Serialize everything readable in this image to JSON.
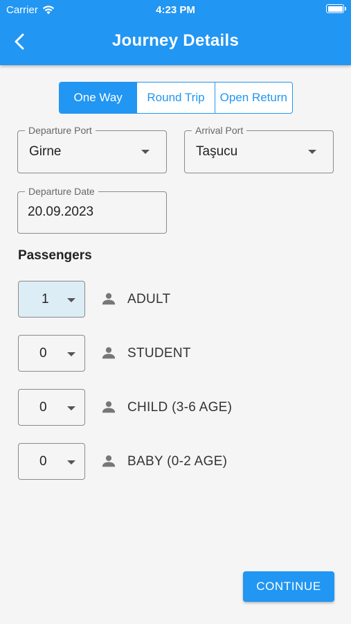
{
  "status": {
    "carrier": "Carrier",
    "time": "4:23 PM"
  },
  "header": {
    "title": "Journey Details"
  },
  "trip_types": [
    {
      "label": "One Way",
      "selected": true
    },
    {
      "label": "Round Trip",
      "selected": false
    },
    {
      "label": "Open Return",
      "selected": false
    }
  ],
  "departure_port": {
    "label": "Departure Port",
    "value": "Girne"
  },
  "arrival_port": {
    "label": "Arrival Port",
    "value": "Taşucu"
  },
  "departure_date": {
    "label": "Departure Date",
    "value": "20.09.2023"
  },
  "passengers": {
    "title": "Passengers",
    "rows": [
      {
        "count": "1",
        "label": "ADULT"
      },
      {
        "count": "0",
        "label": "STUDENT"
      },
      {
        "count": "0",
        "label": "CHILD (3-6 AGE)"
      },
      {
        "count": "0",
        "label": "BABY (0-2 AGE)"
      }
    ]
  },
  "continue_label": "CONTINUE",
  "colors": {
    "primary": "#2196f3",
    "focused_select": "#dcedf6",
    "background": "#f5f5f5"
  },
  "icons": {
    "back": "chevron-left-icon",
    "wifi": "wifi-icon",
    "battery": "battery-icon",
    "person": "person-icon"
  }
}
